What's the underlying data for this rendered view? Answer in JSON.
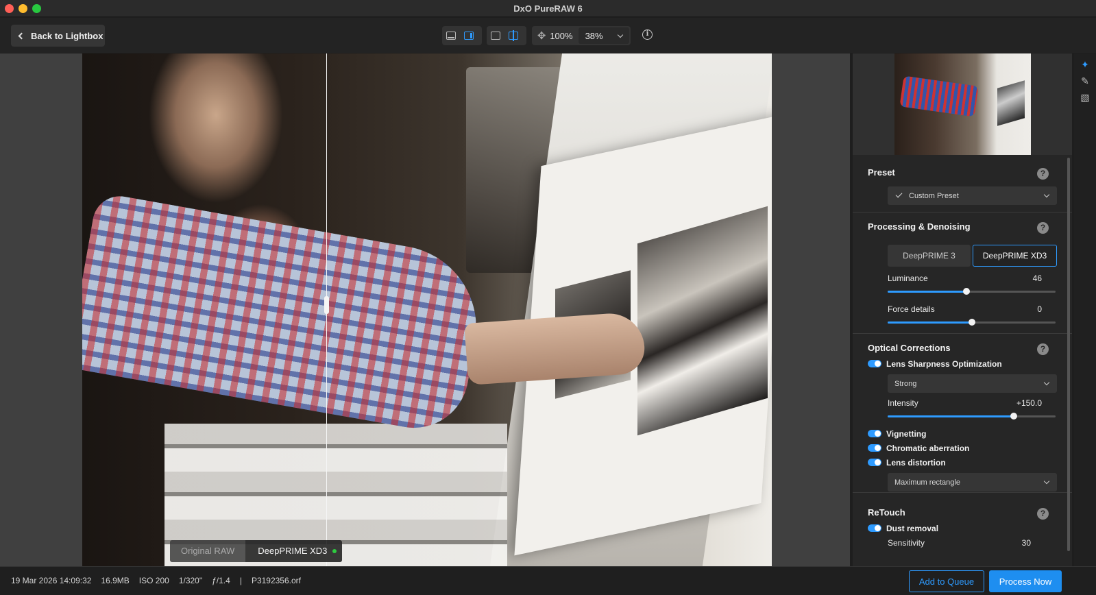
{
  "window": {
    "title": "DxO PureRAW 6"
  },
  "toolbar": {
    "back_label": "Back to Lightbox",
    "zoom_fit": "100%",
    "zoom_value": "38%"
  },
  "viewer": {
    "left_label": "Original RAW",
    "right_label": "DeepPRIME XD3"
  },
  "panel": {
    "preset": {
      "title": "Preset",
      "value": "Custom Preset"
    },
    "processing": {
      "title": "Processing & Denoising",
      "mode_a": "DeepPRIME 3",
      "mode_b": "DeepPRIME XD3",
      "luminance_label": "Luminance",
      "luminance_value": "46",
      "luminance_fraction": 0.47,
      "force_label": "Force details",
      "force_value": "0",
      "force_fraction": 0.5
    },
    "optical": {
      "title": "Optical Corrections",
      "lens_sharpness": "Lens Sharpness Optimization",
      "sharpness_mode": "Strong",
      "intensity_label": "Intensity",
      "intensity_value": "+150.0",
      "intensity_fraction": 0.75,
      "vignetting": "Vignetting",
      "chromatic": "Chromatic aberration",
      "distortion": "Lens distortion",
      "distortion_mode": "Maximum rectangle"
    },
    "retouch": {
      "title": "ReTouch",
      "dust_removal": "Dust removal",
      "sensitivity_label": "Sensitivity",
      "sensitivity_value": "30"
    },
    "help_glyph": "?"
  },
  "status": {
    "date": "19 Mar 2026 14:09:32",
    "size": "16.9MB",
    "iso": "ISO 200",
    "shutter": "1/320\"",
    "aperture": "ƒ/1.4",
    "separator": "|",
    "filename": "P3192356.orf"
  },
  "actions": {
    "queue": "Add to Queue",
    "process": "Process Now"
  },
  "colors": {
    "accent": "#2e9bff",
    "background": "#1e1e1e",
    "panel": "#262626"
  }
}
